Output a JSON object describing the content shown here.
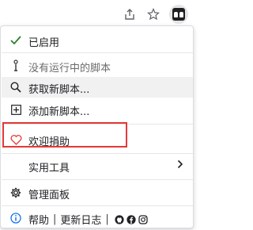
{
  "menu": {
    "enabled": {
      "label": "已启用"
    },
    "no_running": {
      "label": "没有运行中的脚本"
    },
    "get_scripts": {
      "label": "获取新脚本..."
    },
    "add_script": {
      "label": "添加新脚本..."
    },
    "donate": {
      "label": "欢迎捐助"
    },
    "utilities": {
      "label": "实用工具"
    },
    "dashboard": {
      "label": "管理面板"
    },
    "footer": {
      "help": "帮助",
      "separator": "|",
      "changelog": "更新日志",
      "separator2": "|"
    }
  },
  "colors": {
    "check": "#2e7d32",
    "heart": "#e53935",
    "info": "#1a73e8",
    "highlight": "#e53935"
  },
  "icons": {
    "share": "share-icon",
    "star": "bookmark-star-icon",
    "extension": "tampermonkey-icon",
    "enabled": "check-icon",
    "no_running": "info-i-icon",
    "get_scripts": "search-icon",
    "add_script": "plus-square-icon",
    "donate": "heart-icon",
    "utilities": "chevron-right-icon",
    "dashboard": "gear-icon",
    "footer": "info-circle-icon",
    "footer_links": [
      "github-icon",
      "facebook-icon",
      "instagram-icon"
    ]
  }
}
